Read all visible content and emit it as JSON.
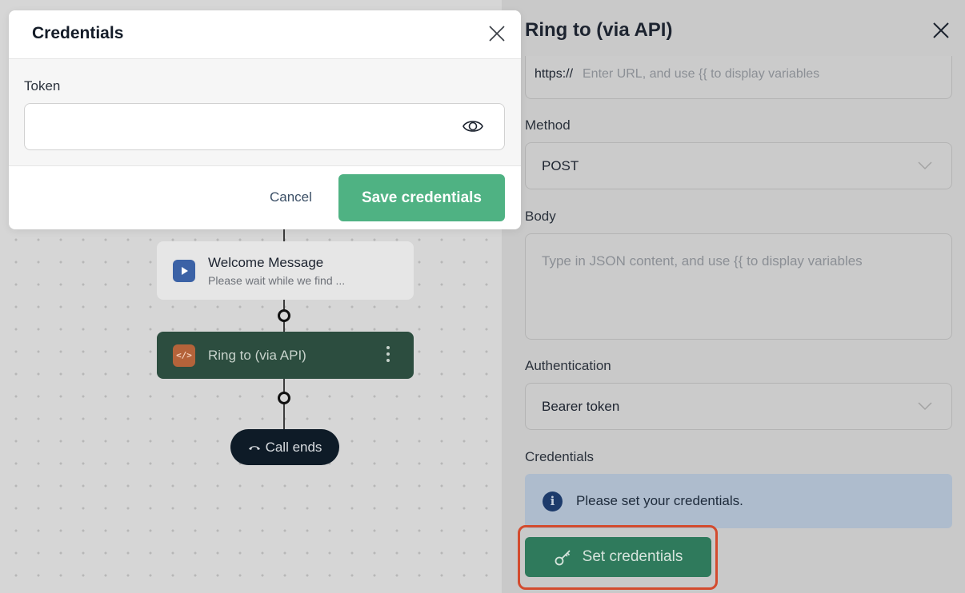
{
  "canvas": {
    "nodes": [
      {
        "title": "Welcome Message",
        "subtitle": "Please wait while we find ...",
        "icon": "play-icon"
      },
      {
        "title": "Ring to (via API)",
        "icon": "code-icon"
      }
    ],
    "call_ends_label": "Call ends"
  },
  "panel": {
    "title": "Ring to (via API)",
    "url_prefix": "https://",
    "url_placeholder": "Enter URL, and use {{ to display variables",
    "method_label": "Method",
    "method_value": "POST",
    "body_label": "Body",
    "body_placeholder": "Type in JSON content, and use {{ to display variables",
    "auth_label": "Authentication",
    "auth_value": "Bearer token",
    "credentials_label": "Credentials",
    "info_text": "Please set your credentials.",
    "set_credentials_label": "Set credentials"
  },
  "modal": {
    "title": "Credentials",
    "token_label": "Token",
    "token_value": "",
    "cancel_label": "Cancel",
    "save_label": "Save credentials"
  },
  "colors": {
    "accent": "#4fb283",
    "node_active": "#2c4d3f",
    "highlight": "#d34b2e"
  }
}
